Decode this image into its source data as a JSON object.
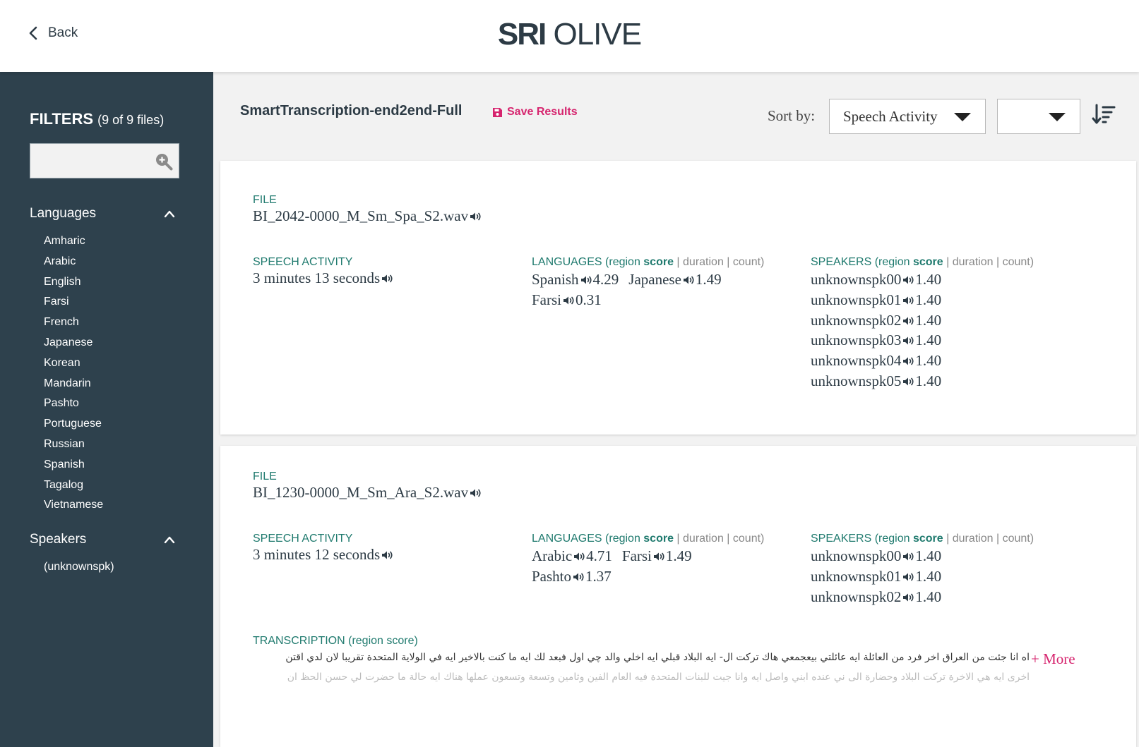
{
  "header": {
    "back_label": "Back",
    "logo_bold": "SRI",
    "logo_light": "OLIVE"
  },
  "sidebar": {
    "filters_title": "FILTERS",
    "filters_count": "(9 of 9 files)",
    "search_placeholder": "",
    "languages_label": "Languages",
    "languages": [
      "Amharic",
      "Arabic",
      "English",
      "Farsi",
      "French",
      "Japanese",
      "Korean",
      "Mandarin",
      "Pashto",
      "Portuguese",
      "Russian",
      "Spanish",
      "Tagalog",
      "Vietnamese"
    ],
    "speakers_label": "Speakers",
    "speakers": [
      "(unknownspk)"
    ]
  },
  "main": {
    "job_title": "SmartTranscription-end2end-Full",
    "save_label": "Save Results",
    "sort_label": "Sort by:",
    "sort_value": "Speech Activity",
    "sort_secondary_value": ""
  },
  "labels": {
    "file": "FILE",
    "speech_activity": "SPEECH ACTIVITY",
    "languages_prefix": "LANGUAGES (region ",
    "speakers_prefix": "SPEAKERS (region ",
    "score": "score",
    "duration": " | duration | count)",
    "transcription": "TRANSCRIPTION (region score)",
    "more": "+ More"
  },
  "results": [
    {
      "file": "BI_2042-0000_M_Sm_Spa_S2.wav",
      "speech_activity": "3 minutes 13 seconds",
      "languages": [
        {
          "name": "Spanish",
          "score": "4.29"
        },
        {
          "name": "Japanese",
          "score": "1.49"
        },
        {
          "name": "Farsi",
          "score": "0.31"
        }
      ],
      "speakers": [
        {
          "name": "unknownspk00",
          "score": "1.40"
        },
        {
          "name": "unknownspk01",
          "score": "1.40"
        },
        {
          "name": "unknownspk02",
          "score": "1.40"
        },
        {
          "name": "unknownspk03",
          "score": "1.40"
        },
        {
          "name": "unknownspk04",
          "score": "1.40"
        },
        {
          "name": "unknownspk05",
          "score": "1.40"
        }
      ]
    },
    {
      "file": "BI_1230-0000_M_Sm_Ara_S2.wav",
      "speech_activity": "3 minutes 12 seconds",
      "languages": [
        {
          "name": "Arabic",
          "score": "4.71"
        },
        {
          "name": "Farsi",
          "score": "1.49"
        },
        {
          "name": "Pashto",
          "score": "1.37"
        }
      ],
      "speakers": [
        {
          "name": "unknownspk00",
          "score": "1.40"
        },
        {
          "name": "unknownspk01",
          "score": "1.40"
        },
        {
          "name": "unknownspk02",
          "score": "1.40"
        }
      ],
      "transcription_lines": [
        "اه انا جئت من العراق اخر فرد من العائلة ايه عائلتي بيعجمعي هاك تركت ال- ايه البلاد قبلي ايه اخلي والد چي اول فبعد لك ايه ما كنت بالاخير ايه في الولاية المتحدة تقريبا لان لدي اقتن",
        "اخرى ايه هي الاخرة تركت البلاد وحضارة الى ني عنده ابني واصل ايه وانا جيت للبنات المتحدة فيه العام الفين وثامين وتسعة وتسعون عملها هناك ايه حالة ما حضرت لي حسن الحظ ان"
      ]
    }
  ],
  "colors": {
    "sidebar_bg": "#2e414d",
    "accent_pink": "#d6246e",
    "label_teal": "#1f7a6e",
    "text_dark": "#2d3b45"
  }
}
